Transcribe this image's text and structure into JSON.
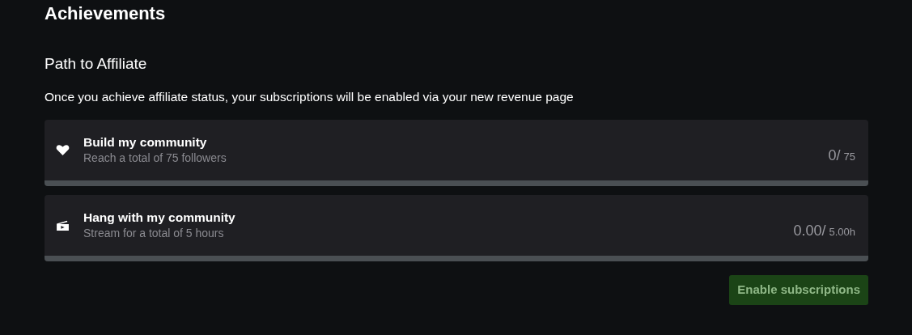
{
  "page_title": "Achievements",
  "section_title": "Path to Affiliate",
  "description": "Once you achieve affiliate status, your subscriptions will be enabled via your new revenue page",
  "goals": [
    {
      "kind": "followers",
      "title": "Build my community",
      "subtitle": "Reach a total of 75 followers",
      "current": "0/",
      "target": "75",
      "level": 0
    },
    {
      "kind": "hours",
      "title": "Hang with my community",
      "subtitle": "Stream for a total of 5 hours",
      "current": "0.00/",
      "target": "5.00h",
      "level": 0
    }
  ],
  "button": {
    "label": "Enable subscriptions",
    "disabled": true
  }
}
